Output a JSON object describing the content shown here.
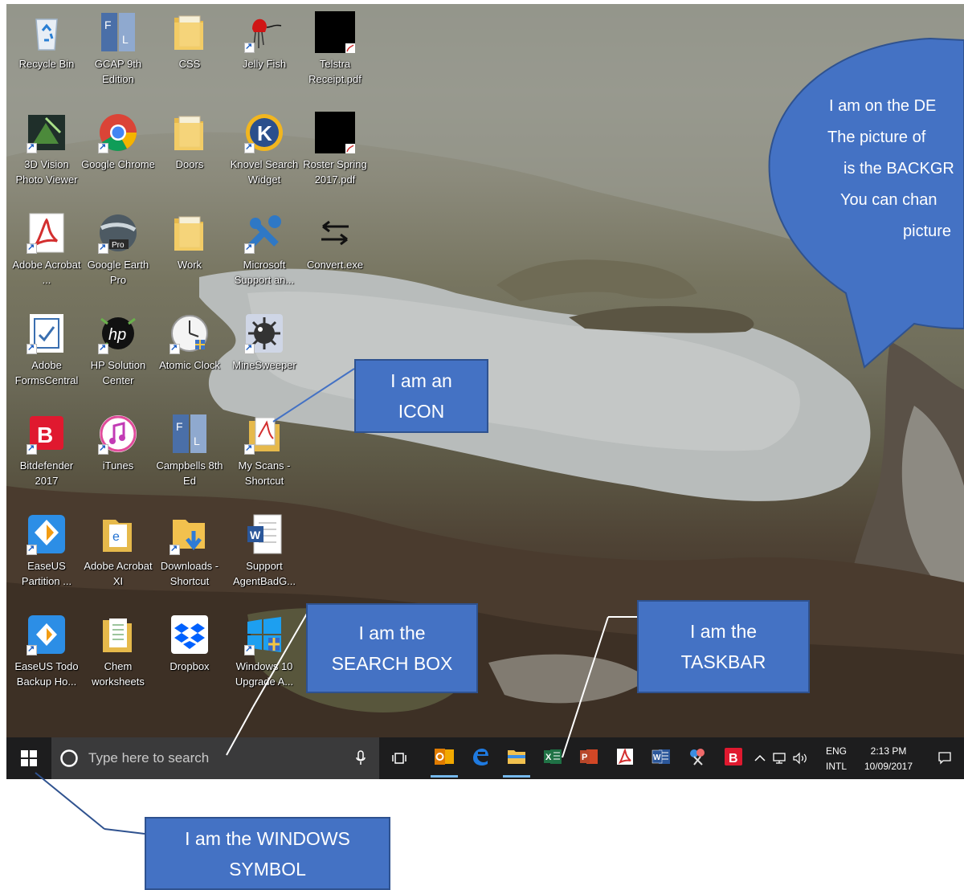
{
  "desktop": {
    "icons": [
      {
        "label": "Recycle Bin",
        "icon": "recycle-bin-icon",
        "shortcut": false
      },
      {
        "label": "GCAP 9th Edition",
        "icon": "gcap-book-icon",
        "shortcut": false
      },
      {
        "label": "CSS",
        "icon": "folder-icon",
        "shortcut": false
      },
      {
        "label": "Jelly Fish",
        "icon": "jellyfish-icon",
        "shortcut": true
      },
      {
        "label": "Telstra Receipt.pdf",
        "icon": "pdf-file-icon",
        "shortcut": false
      },
      {
        "label": "3D Vision Photo Viewer",
        "icon": "3d-vision-icon",
        "shortcut": true
      },
      {
        "label": "Google Chrome",
        "icon": "chrome-icon",
        "shortcut": true
      },
      {
        "label": "Doors",
        "icon": "folder-icon",
        "shortcut": false
      },
      {
        "label": "Knovel Search Widget",
        "icon": "knovel-icon",
        "shortcut": true
      },
      {
        "label": "Roster Spring 2017.pdf",
        "icon": "pdf-file-icon",
        "shortcut": false
      },
      {
        "label": "Adobe Acrobat ...",
        "icon": "adobe-acrobat-icon",
        "shortcut": true
      },
      {
        "label": "Google Earth Pro",
        "icon": "google-earth-icon",
        "shortcut": true
      },
      {
        "label": "Work",
        "icon": "folder-icon",
        "shortcut": false
      },
      {
        "label": "Microsoft Support an...",
        "icon": "microsoft-support-icon",
        "shortcut": true
      },
      {
        "label": "Convert.exe",
        "icon": "convert-arrows-icon",
        "shortcut": false
      },
      {
        "label": "Adobe FormsCentral",
        "icon": "forms-central-icon",
        "shortcut": true
      },
      {
        "label": "HP Solution Center",
        "icon": "hp-icon",
        "shortcut": true
      },
      {
        "label": "Atomic Clock",
        "icon": "clock-icon",
        "shortcut": true
      },
      {
        "label": "MineSweeper",
        "icon": "minesweeper-icon",
        "shortcut": true
      },
      {
        "label": "",
        "icon": "",
        "shortcut": false
      },
      {
        "label": "Bitdefender 2017",
        "icon": "bitdefender-icon",
        "shortcut": true
      },
      {
        "label": "iTunes",
        "icon": "itunes-icon",
        "shortcut": true
      },
      {
        "label": "Campbells 8th Ed",
        "icon": "campbells-book-icon",
        "shortcut": false
      },
      {
        "label": "My Scans - Shortcut",
        "icon": "scans-folder-icon",
        "shortcut": true
      },
      {
        "label": "",
        "icon": "",
        "shortcut": false
      },
      {
        "label": "EaseUS Partition ...",
        "icon": "easeus-partition-icon",
        "shortcut": true
      },
      {
        "label": "Adobe Acrobat XI",
        "icon": "adobe-xi-folder-icon",
        "shortcut": false
      },
      {
        "label": "Downloads - Shortcut",
        "icon": "downloads-folder-icon",
        "shortcut": true
      },
      {
        "label": "Support AgentBadG...",
        "icon": "word-document-icon",
        "shortcut": false
      },
      {
        "label": "",
        "icon": "",
        "shortcut": false
      },
      {
        "label": "EaseUS Todo Backup Ho...",
        "icon": "easeus-todo-icon",
        "shortcut": true
      },
      {
        "label": "Chem worksheets",
        "icon": "worksheets-folder-icon",
        "shortcut": false
      },
      {
        "label": "Dropbox",
        "icon": "dropbox-icon",
        "shortcut": false
      },
      {
        "label": "Windows 10 Upgrade A...",
        "icon": "windows-upgrade-icon",
        "shortcut": true
      }
    ]
  },
  "taskbar": {
    "search_placeholder": "Type here to search",
    "apps": [
      {
        "icon": "outlook-icon",
        "running": true
      },
      {
        "icon": "edge-icon",
        "running": false
      },
      {
        "icon": "file-explorer-icon",
        "running": true
      },
      {
        "icon": "excel-icon",
        "running": false
      },
      {
        "icon": "powerpoint-icon",
        "running": false
      },
      {
        "icon": "acrobat-icon",
        "running": false
      },
      {
        "icon": "word-icon",
        "running": false
      },
      {
        "icon": "snipping-tool-icon",
        "running": false
      },
      {
        "icon": "bitdefender-icon",
        "running": false
      }
    ],
    "tray": {
      "lang_line1": "ENG",
      "lang_line2": "INTL",
      "time": "2:13 PM",
      "date": "10/09/2017"
    }
  },
  "callouts": {
    "bubble": [
      "I am on the DE",
      "The picture of",
      "is the BACKGR",
      "You can chan",
      "picture"
    ],
    "icon": [
      "I am an",
      "ICON"
    ],
    "search": [
      "I am the",
      "SEARCH BOX"
    ],
    "taskbar": [
      "I am the",
      "TASKBAR"
    ],
    "windows": [
      "I am the WINDOWS",
      "SYMBOL"
    ]
  },
  "colors": {
    "callout_fill": "#4472c4",
    "callout_border": "#2f528f",
    "taskbar": "#1d1d1e",
    "search_box": "#3a3a3b",
    "running_indicator": "#76b9ed"
  }
}
